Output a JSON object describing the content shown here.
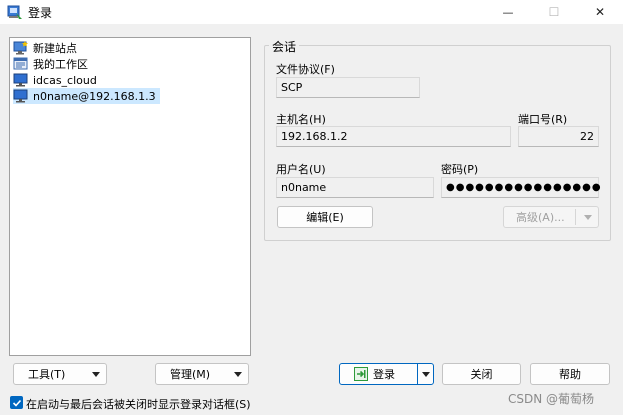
{
  "window": {
    "title": "登录",
    "min_glyph": "—",
    "max_glyph": "☐",
    "close_glyph": "✕"
  },
  "sites": [
    {
      "label": "新建站点",
      "icon": "new-site-icon"
    },
    {
      "label": "我的工作区",
      "icon": "workspace-icon"
    },
    {
      "label": "idcas_cloud",
      "icon": "computer-icon"
    },
    {
      "label": "n0name@192.168.1.3",
      "icon": "computer-icon",
      "selected": true
    }
  ],
  "session": {
    "group_label": "会话",
    "protocol_label": "文件协议(F)",
    "protocol_value": "SCP",
    "host_label": "主机名(H)",
    "host_value": "192.168.1.2",
    "port_label": "端口号(R)",
    "port_value": "22",
    "user_label": "用户名(U)",
    "user_value": "n0name",
    "password_label": "密码(P)",
    "password_value": "●●●●●●●●●●●●●●●●",
    "edit_label": "编辑(E)",
    "advanced_label": "高级(A)..."
  },
  "buttons": {
    "tools_label": "工具(T)",
    "manage_label": "管理(M)",
    "login_label": "登录",
    "close_label": "关闭",
    "help_label": "帮助"
  },
  "footer": {
    "checkbox_label": "在启动与最后会话被关闭时显示登录对话框(S)",
    "checkbox_checked": true,
    "watermark": "CSDN @葡萄杨"
  },
  "colors": {
    "accent": "#0067c0",
    "selection": "#cce8ff",
    "login_icon_green": "#2e9a3a"
  }
}
